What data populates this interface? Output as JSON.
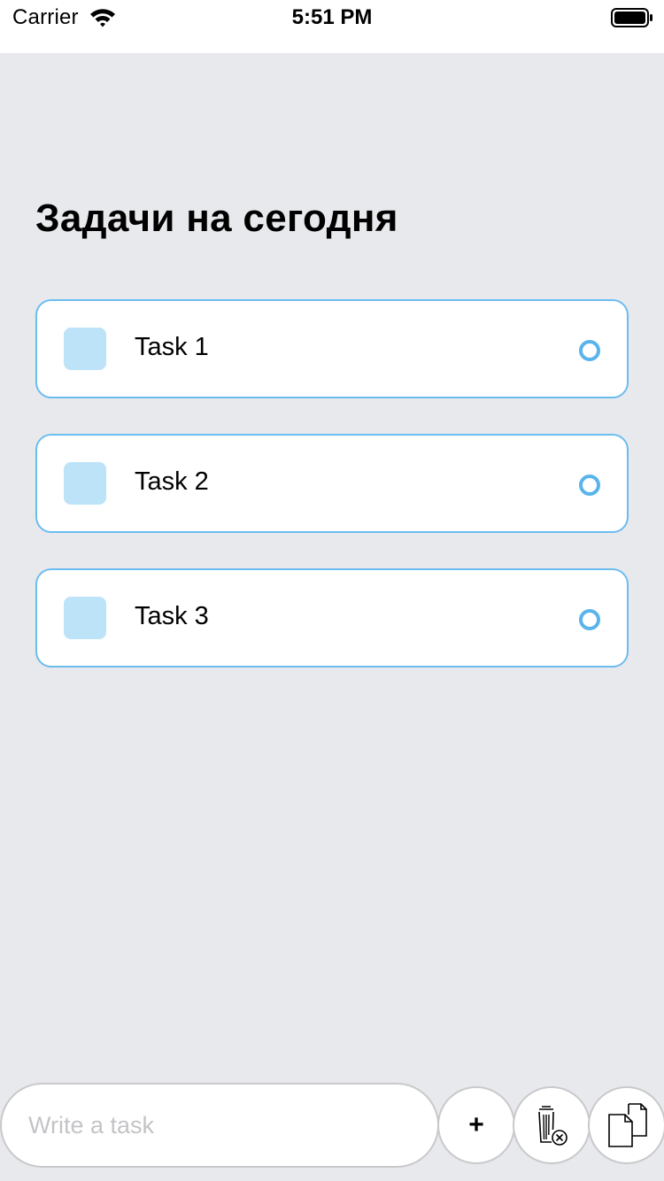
{
  "status_bar": {
    "carrier": "Carrier",
    "time": "5:51 PM",
    "wifi_icon": "wifi-icon",
    "battery_icon": "battery-icon"
  },
  "title": "Задачи на сегодня",
  "tasks": [
    {
      "label": "Task 1"
    },
    {
      "label": "Task 2"
    },
    {
      "label": "Task 3"
    }
  ],
  "composer": {
    "placeholder": "Write a task",
    "value": "",
    "add_label": "+",
    "delete_icon": "trash-icon",
    "copy_icon": "copy-icon"
  },
  "colors": {
    "background": "#e8e9ed",
    "card_border": "#6cbcf0",
    "checkbox_fill": "#bde3f8",
    "status_ring": "#5ab4ec"
  }
}
